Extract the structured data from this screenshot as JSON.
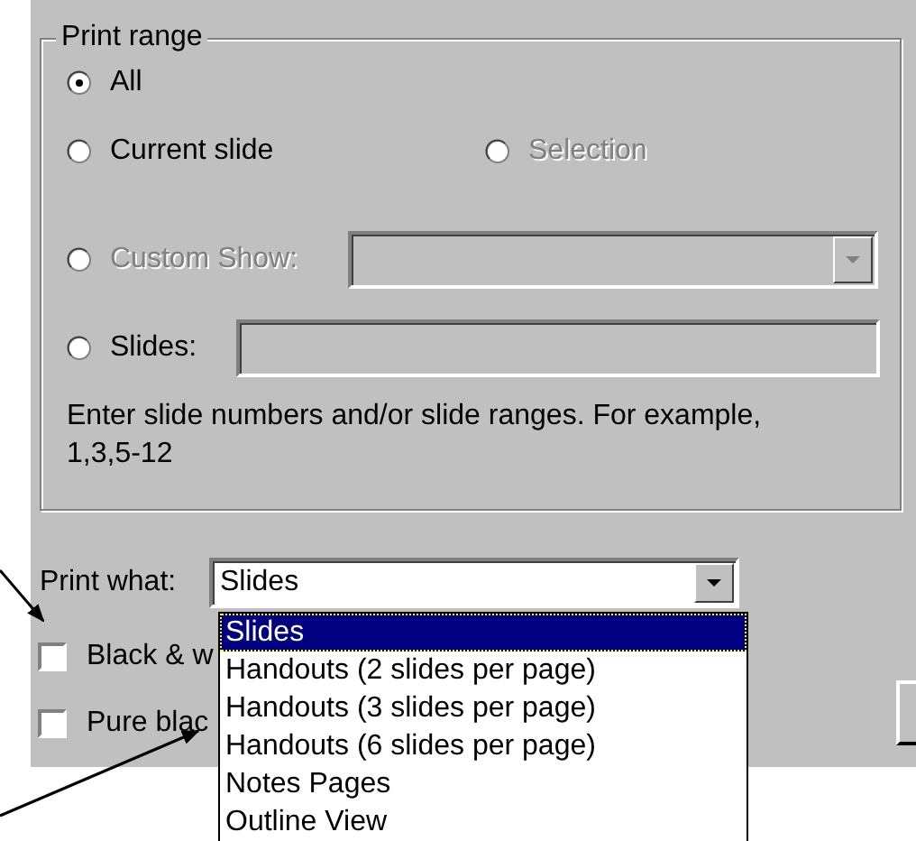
{
  "print_range": {
    "title": "Print range",
    "rows": [
      {
        "options": [
          {
            "label": "All",
            "kind": "plain",
            "selected": true,
            "disabled": false
          }
        ]
      },
      {
        "options": [
          {
            "label": "Current slide",
            "kind": "plain",
            "selected": false,
            "disabled": false
          },
          {
            "label": "Selection",
            "kind": "plain",
            "selected": false,
            "disabled": true
          }
        ]
      },
      {
        "options": [
          {
            "label": "Custom Show:",
            "kind": "combo",
            "selected": false,
            "disabled": true
          }
        ]
      },
      {
        "options": [
          {
            "label": "Slides:",
            "kind": "field",
            "selected": false,
            "disabled": false
          }
        ]
      }
    ],
    "hint": "Enter slide numbers and/or slide ranges. For example, 1,3,5-12"
  },
  "print_what": {
    "label": "Print what:",
    "value": "Slides",
    "expanded": true,
    "items": [
      {
        "label": "Slides",
        "selected": true
      },
      {
        "label": "Handouts (2 slides per page)",
        "selected": false
      },
      {
        "label": "Handouts (3 slides per page)",
        "selected": false
      },
      {
        "label": "Handouts (6 slides per page)",
        "selected": false
      },
      {
        "label": "Notes Pages",
        "selected": false
      },
      {
        "label": "Outline View",
        "selected": false
      }
    ]
  },
  "checkboxes": [
    {
      "label": "Black & w",
      "checked": false
    },
    {
      "label": "Pure blac",
      "checked": false
    }
  ]
}
